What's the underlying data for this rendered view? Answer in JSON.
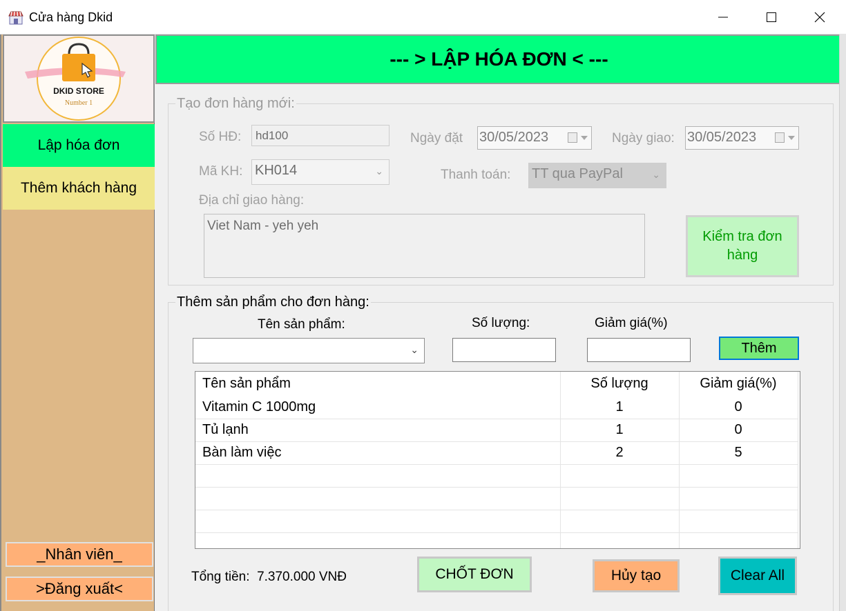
{
  "window": {
    "title": "Cửa hàng Dkid",
    "controls": {
      "minimize": "minimize-icon",
      "maximize": "maximize-icon",
      "close": "close-icon"
    }
  },
  "sidebar": {
    "logo": {
      "name": "DKID STORE",
      "tagline": "Number 1"
    },
    "items": [
      {
        "label": "Lập hóa đơn",
        "active": true
      },
      {
        "label": "Thêm khách hàng",
        "active": false
      }
    ],
    "staff_button": "_Nhân viên_",
    "logout_button": ">Đăng xuất<"
  },
  "header": {
    "title": "--- > LẬP HÓA ĐƠN < ---"
  },
  "order_group": {
    "legend": "Tạo đơn hàng mới:",
    "invoice_no_label": "Số HĐ:",
    "invoice_no": "hd100",
    "order_date_label": "Ngày đặt",
    "order_date": "30/05/2023",
    "delivery_date_label": "Ngày giao:",
    "delivery_date": "30/05/2023",
    "customer_label": "Mã KH:",
    "customer_id": "KH014",
    "payment_label": "Thanh toán:",
    "payment_method": "TT qua PayPal",
    "address_label": "Địa chỉ giao hàng:",
    "address": "Viet Nam - yeh yeh",
    "check_button": "Kiểm tra đơn hàng"
  },
  "product_group": {
    "legend": "Thêm sản phẩm cho đơn hàng:",
    "product_name_label": "Tên sản phẩm:",
    "quantity_label": "Số lượng:",
    "discount_label": "Giảm giá(%)",
    "product_value": "",
    "quantity_value": "",
    "discount_value": "",
    "add_button": "Thêm"
  },
  "table": {
    "columns": [
      "Tên sản phẩm",
      "Số lượng",
      "Giảm giá(%)"
    ],
    "rows": [
      [
        "Vitamin C 1000mg",
        "1",
        "0"
      ],
      [
        "Tủ lạnh",
        "1",
        "0"
      ],
      [
        "Bàn làm việc",
        "2",
        "5"
      ]
    ]
  },
  "footer": {
    "total_label": "Tổng tiền:",
    "total_value": "7.370.000 VNĐ",
    "confirm_button": "CHỐT ĐƠN",
    "cancel_button": "Hủy tạo",
    "clear_button": "Clear All"
  },
  "colors": {
    "accent_green": "#00ff7f",
    "sidebar_bg": "#deb887",
    "nav_active": "#00fa7d",
    "nav_customer": "#f0e68c",
    "orange_button": "#ffb077",
    "clear_button": "#00bfbf",
    "light_green_button": "#c1f7c2"
  }
}
